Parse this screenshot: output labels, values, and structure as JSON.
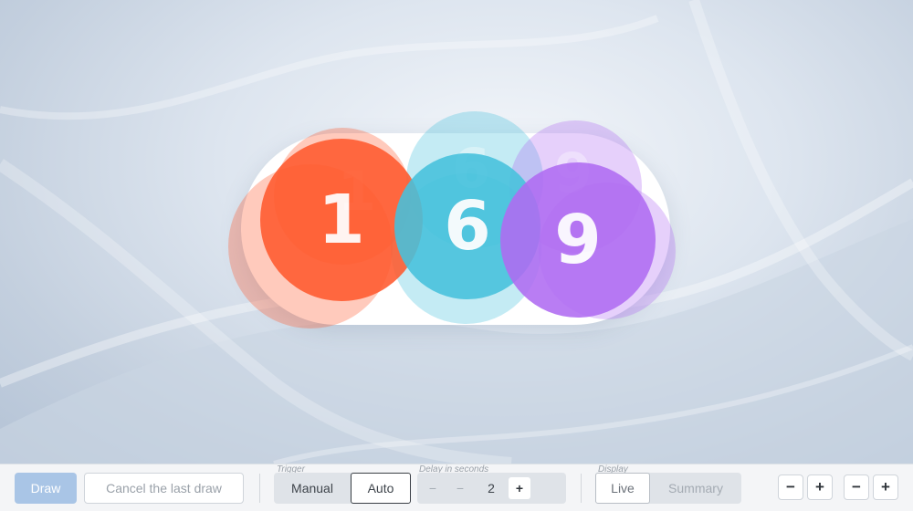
{
  "drawn_numbers": [
    {
      "value": "1",
      "color": "#ff5a2e"
    },
    {
      "value": "6",
      "color": "#46c2dd"
    },
    {
      "value": "9",
      "color": "#b06cf2"
    }
  ],
  "ghost_numbers": [
    "1",
    "6",
    "9"
  ],
  "toolbar": {
    "draw_label": "Draw",
    "cancel_label": "Cancel the last draw",
    "trigger": {
      "label": "Trigger",
      "options": [
        "Manual",
        "Auto"
      ],
      "selected": "Auto"
    },
    "delay": {
      "label": "Delay in seconds",
      "value": "2",
      "minus_label": "−",
      "plus_label": "+"
    },
    "display": {
      "label": "Display",
      "options": [
        "Live",
        "Summary"
      ],
      "selected": "Live"
    },
    "zoom": {
      "minus_label": "−",
      "plus_label": "+"
    }
  },
  "colors": {
    "draw_button": "#a9c5e6",
    "accent_active_border": "#3a3f45"
  }
}
